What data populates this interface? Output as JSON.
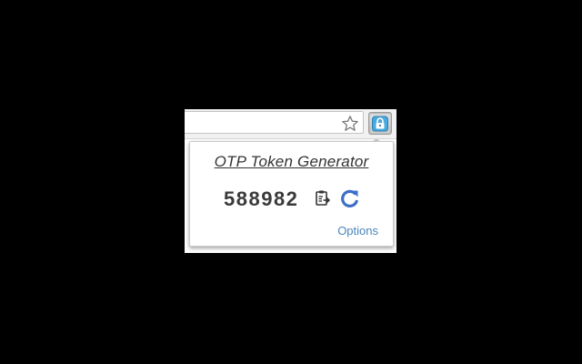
{
  "toolbar": {
    "star_icon": "star-outline-icon",
    "extension_icon": "lock-badge-icon"
  },
  "popup": {
    "title": "OTP Token Generator",
    "token": "588982",
    "copy_icon": "clipboard-copy-icon",
    "refresh_icon": "refresh-icon",
    "options_label": "Options"
  },
  "colors": {
    "background": "#000000",
    "refresh_blue": "#3d6fc9",
    "link_blue": "#4a86b8",
    "extension_blue": "#4aa9de"
  }
}
